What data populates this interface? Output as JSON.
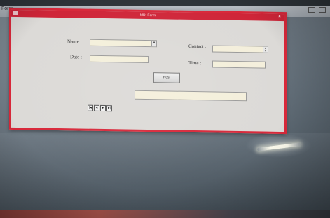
{
  "window": {
    "title": "MDI Form",
    "close_glyph": "×",
    "accent_color": "#d8283a"
  },
  "background_window": {
    "label": "Form"
  },
  "form": {
    "name_label": "Name :",
    "contact_label": "Contact :",
    "date_label": "Date :",
    "time_label": "Time :",
    "name_value": "",
    "contact_value": "",
    "date_value": "",
    "time_value": "",
    "dropdown_glyph": "▾",
    "post_button_label": "Post",
    "output_value": ""
  },
  "navigation": {
    "first": "|◂",
    "prev": "◂",
    "next": "▸",
    "last": "▸|"
  }
}
